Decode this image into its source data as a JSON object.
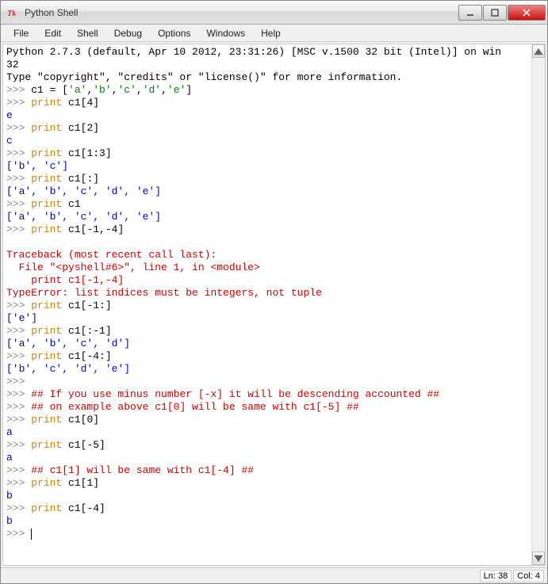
{
  "window": {
    "title": "Python Shell",
    "icon_label": "Tk"
  },
  "menu": [
    "File",
    "Edit",
    "Shell",
    "Debug",
    "Options",
    "Windows",
    "Help"
  ],
  "banner": {
    "line1": "Python 2.7.3 (default, Apr 10 2012, 23:31:26) [MSC v.1500 32 bit (Intel)] on win",
    "line2": "32",
    "line3": "Type \"copyright\", \"credits\" or \"license()\" for more information."
  },
  "prompt": ">>>",
  "session": {
    "l0_cmd": "c1 = ['a','b','c','d','e']",
    "l1_kw": "print",
    "l1_rest": " c1[4]",
    "l1_out": "e",
    "l2_kw": "print",
    "l2_rest": " c1[2]",
    "l2_out": "c",
    "l3_kw": "print",
    "l3_rest": " c1[1:3]",
    "l3_out": "['b', 'c']",
    "l4_kw": "print",
    "l4_rest": " c1[:]",
    "l4_out": "['a', 'b', 'c', 'd', 'e']",
    "l5_kw": "print",
    "l5_rest": " c1",
    "l5_out": "['a', 'b', 'c', 'd', 'e']",
    "l6_kw": "print",
    "l6_rest": " c1[-1,-4]",
    "tb1": "Traceback (most recent call last):",
    "tb2": "  File \"<pyshell#6>\", line 1, in <module>",
    "tb3": "    print c1[-1,-4]",
    "tb4": "TypeError: list indices must be integers, not tuple",
    "l7_kw": "print",
    "l7_rest": " c1[-1:]",
    "l7_out": "['e']",
    "l8_kw": "print",
    "l8_rest": " c1[:-1]",
    "l8_out": "['a', 'b', 'c', 'd']",
    "l9_kw": "print",
    "l9_rest": " c1[-4:]",
    "l9_out": "['b', 'c', 'd', 'e']",
    "c1": "## If you use minus number [-x] it will be descending accounted ##",
    "c2": "## on example above c1[0] will be same with c1[-5] ##",
    "l10_kw": "print",
    "l10_rest": " c1[0]",
    "l10_out": "a",
    "l11_kw": "print",
    "l11_rest": " c1[-5]",
    "l11_out": "a",
    "c3": "## c1[1] will be same with c1[-4] ##",
    "l12_kw": "print",
    "l12_rest": " c1[1]",
    "l12_out": "b",
    "l13_kw": "print",
    "l13_rest": " c1[-4]",
    "l13_out": "b"
  },
  "status": {
    "line": "Ln: 38",
    "col": "Col: 4"
  }
}
